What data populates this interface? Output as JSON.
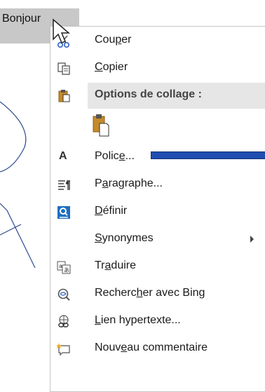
{
  "document": {
    "selected_word": "Bonjour"
  },
  "menu": {
    "items": [
      {
        "key": "cut",
        "pre": "Cou",
        "ul": "p",
        "post": "er",
        "icon": "scissors-icon"
      },
      {
        "key": "copy",
        "pre": "",
        "ul": "C",
        "post": "opier",
        "icon": "copy-icon"
      },
      {
        "key": "paste_options",
        "pre": "Options de collage :",
        "ul": "",
        "post": "",
        "icon": "clipboard-icon",
        "header": true
      },
      {
        "key": "paste_keep",
        "pre": "",
        "ul": "",
        "post": "",
        "icon": "paste-keep-format-icon"
      },
      {
        "key": "font",
        "pre": "Polic",
        "ul": "e",
        "post": "...",
        "icon": "font-a-icon"
      },
      {
        "key": "paragraph",
        "pre": "P",
        "ul": "a",
        "post": "ragraphe...",
        "icon": "paragraph-icon"
      },
      {
        "key": "define",
        "pre": "",
        "ul": "D",
        "post": "éfinir",
        "icon": "define-icon"
      },
      {
        "key": "synonyms",
        "pre": "",
        "ul": "S",
        "post": "ynonymes",
        "icon": "",
        "submenu": true
      },
      {
        "key": "translate",
        "pre": "Tr",
        "ul": "a",
        "post": "duire",
        "icon": "translate-icon"
      },
      {
        "key": "bing",
        "pre": "Recherc",
        "ul": "h",
        "post": "er avec Bing",
        "icon": "bing-search-icon"
      },
      {
        "key": "hyperlink",
        "pre": "",
        "ul": "L",
        "post": "ien hypertexte...",
        "icon": "hyperlink-icon"
      },
      {
        "key": "comment",
        "pre": "Nouv",
        "ul": "e",
        "post": "au commentaire",
        "icon": "new-comment-icon"
      }
    ]
  }
}
